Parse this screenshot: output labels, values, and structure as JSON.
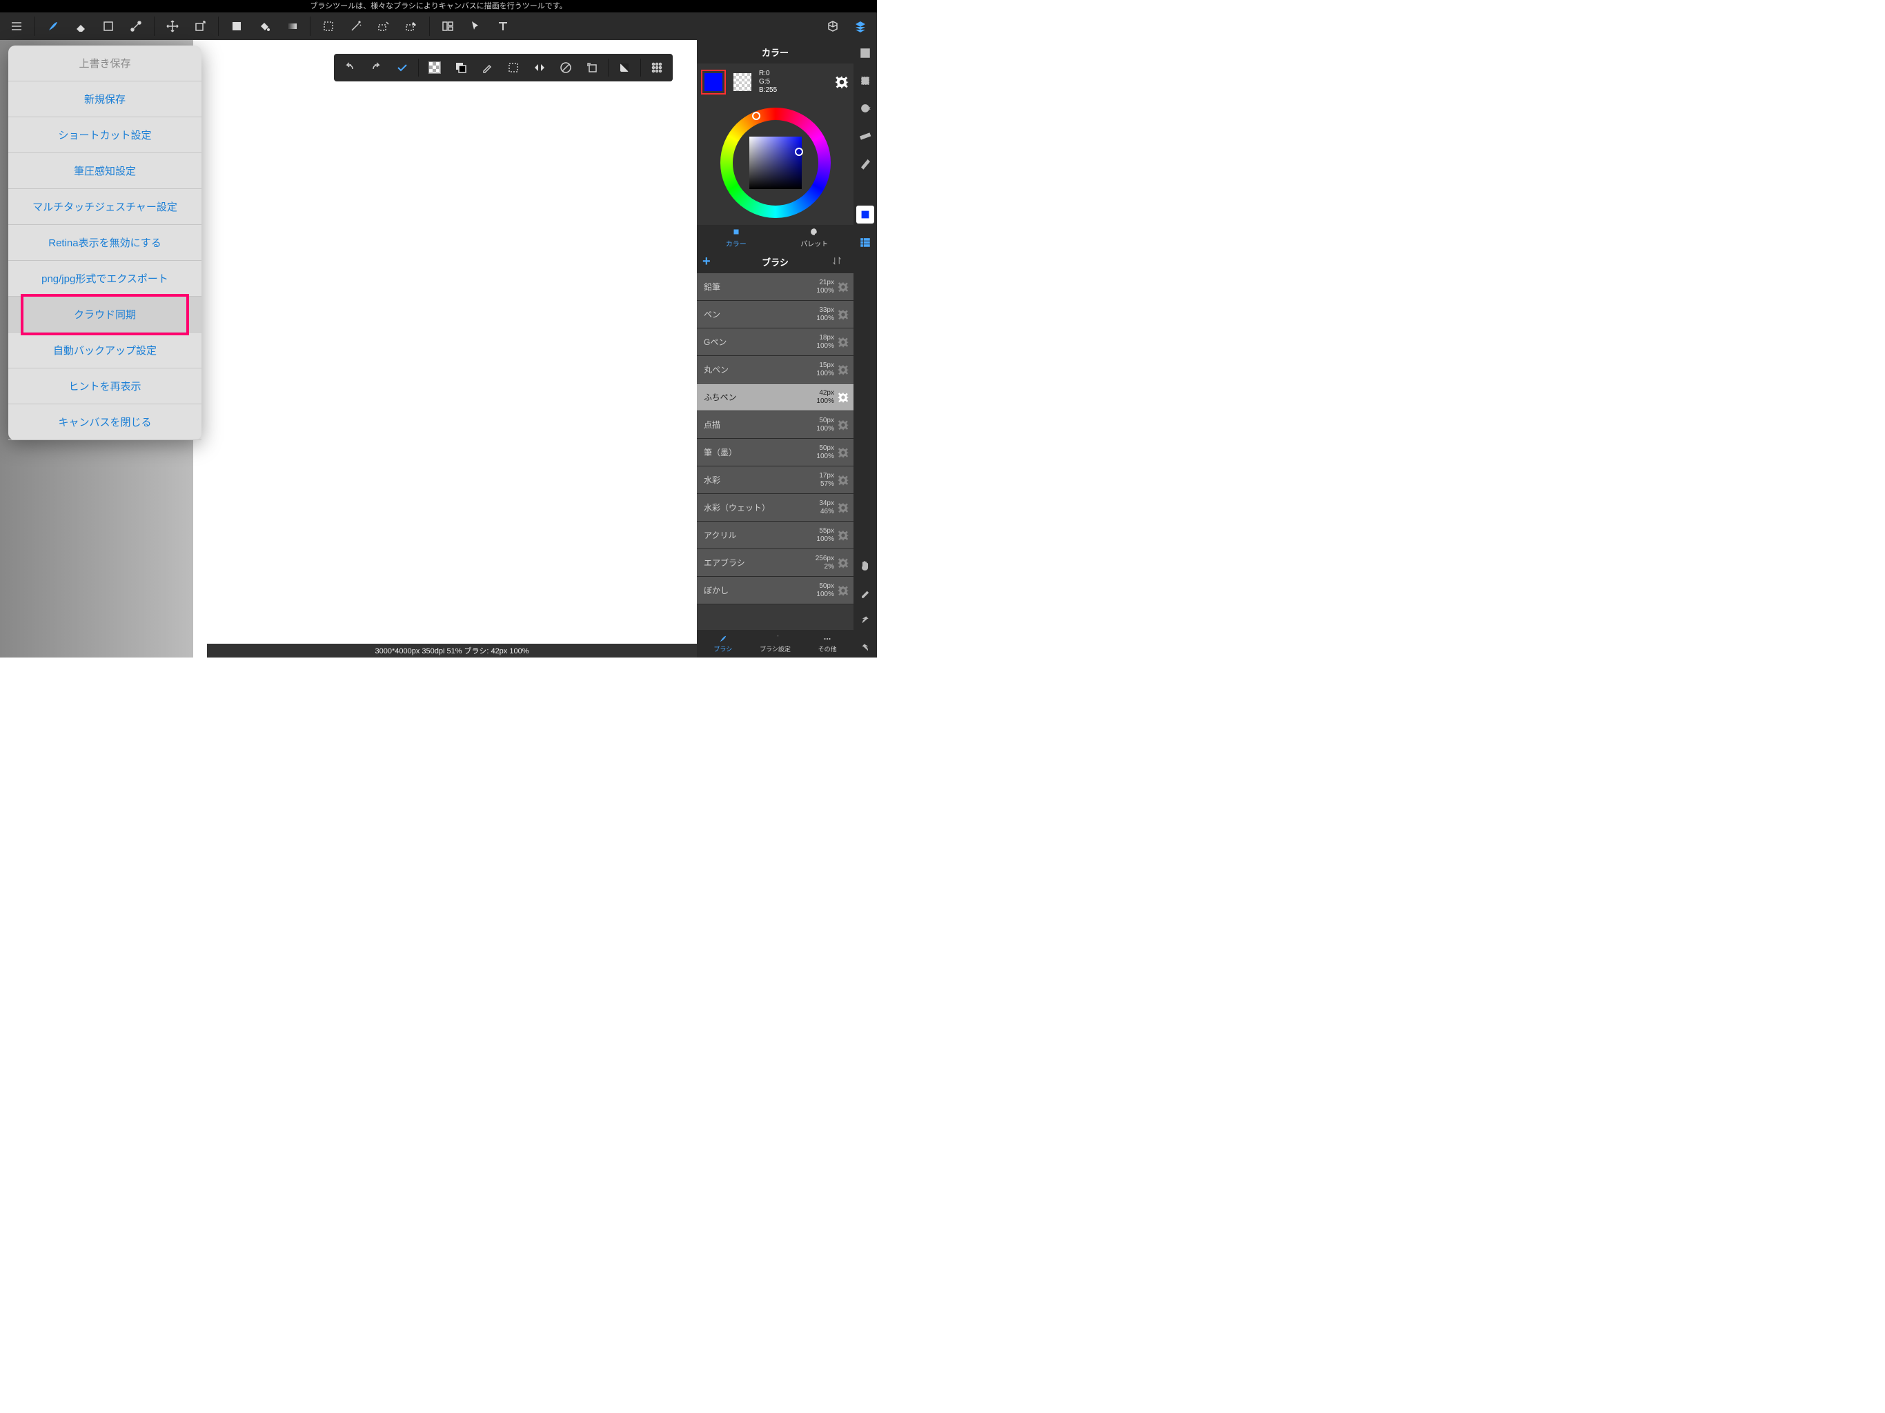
{
  "hint": "ブラシツールは、様々なブラシによりキャンバスに描画を行うツールです。",
  "menu": {
    "items": [
      {
        "label": "上書き保存",
        "disabled": true
      },
      {
        "label": "新規保存"
      },
      {
        "label": "ショートカット設定"
      },
      {
        "label": "筆圧感知設定"
      },
      {
        "label": "マルチタッチジェスチャー設定"
      },
      {
        "label": "Retina表示を無効にする"
      },
      {
        "label": "png/jpg形式でエクスポート"
      },
      {
        "label": "クラウド同期",
        "highlighted": true
      },
      {
        "label": "自動バックアップ設定"
      },
      {
        "label": "ヒントを再表示"
      },
      {
        "label": "キャンバスを閉じる"
      }
    ]
  },
  "color_panel": {
    "title": "カラー",
    "rgb": {
      "r": "R:0",
      "g": "G:5",
      "b": "B:255"
    },
    "fg_color": "#0008ff",
    "tabs": {
      "color": "カラー",
      "palette": "パレット"
    }
  },
  "brush_panel": {
    "title": "ブラシ",
    "tabs": {
      "brush": "ブラシ",
      "settings": "ブラシ設定",
      "other": "その他"
    },
    "items": [
      {
        "name": "鉛筆",
        "size": "21px",
        "opacity": "100%"
      },
      {
        "name": "ペン",
        "size": "33px",
        "opacity": "100%"
      },
      {
        "name": "Gペン",
        "size": "18px",
        "opacity": "100%"
      },
      {
        "name": "丸ペン",
        "size": "15px",
        "opacity": "100%"
      },
      {
        "name": "ふちペン",
        "size": "42px",
        "opacity": "100%",
        "selected": true
      },
      {
        "name": "点描",
        "size": "50px",
        "opacity": "100%"
      },
      {
        "name": "筆（墨）",
        "size": "50px",
        "opacity": "100%"
      },
      {
        "name": "水彩",
        "size": "17px",
        "opacity": "57%"
      },
      {
        "name": "水彩（ウェット）",
        "size": "34px",
        "opacity": "46%"
      },
      {
        "name": "アクリル",
        "size": "55px",
        "opacity": "100%"
      },
      {
        "name": "エアブラシ",
        "size": "256px",
        "opacity": "2%"
      },
      {
        "name": "ぼかし",
        "size": "50px",
        "opacity": "100%"
      }
    ]
  },
  "status": "3000*4000px 350dpi 51% ブラシ: 42px 100%"
}
